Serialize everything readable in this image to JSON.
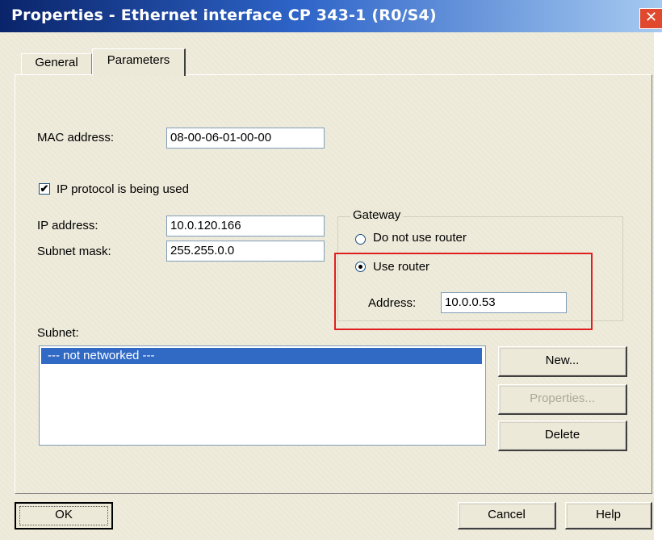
{
  "window": {
    "title": "Properties - Ethernet interface  CP 343-1 (R0/S4)",
    "close_glyph": "✕"
  },
  "tabs": [
    {
      "label": "General",
      "active": false
    },
    {
      "label": "Parameters",
      "active": true
    }
  ],
  "parameters": {
    "mac_label": "MAC address:",
    "mac_value": "08-00-06-01-00-00",
    "ip_protocol_label": "IP protocol is being used",
    "ip_protocol_checked": true,
    "ip_label": "IP address:",
    "ip_value": "10.0.120.166",
    "subnet_mask_label": "Subnet mask:",
    "subnet_mask_value": "255.255.0.0"
  },
  "gateway": {
    "title": "Gateway",
    "option_no_router": "Do not use router",
    "option_use_router": "Use router",
    "selected": "use_router",
    "address_label": "Address:",
    "address_value": "10.0.0.53"
  },
  "subnet": {
    "label": "Subnet:",
    "items": [
      "--- not networked ---"
    ],
    "selected_index": 0
  },
  "side_buttons": {
    "new": "New...",
    "properties": "Properties...",
    "delete": "Delete"
  },
  "footer": {
    "ok": "OK",
    "cancel": "Cancel",
    "help": "Help"
  },
  "colors": {
    "title_start": "#0a246a",
    "selection": "#316ac5",
    "highlight_box": "#e02020",
    "close": "#e0492e"
  }
}
